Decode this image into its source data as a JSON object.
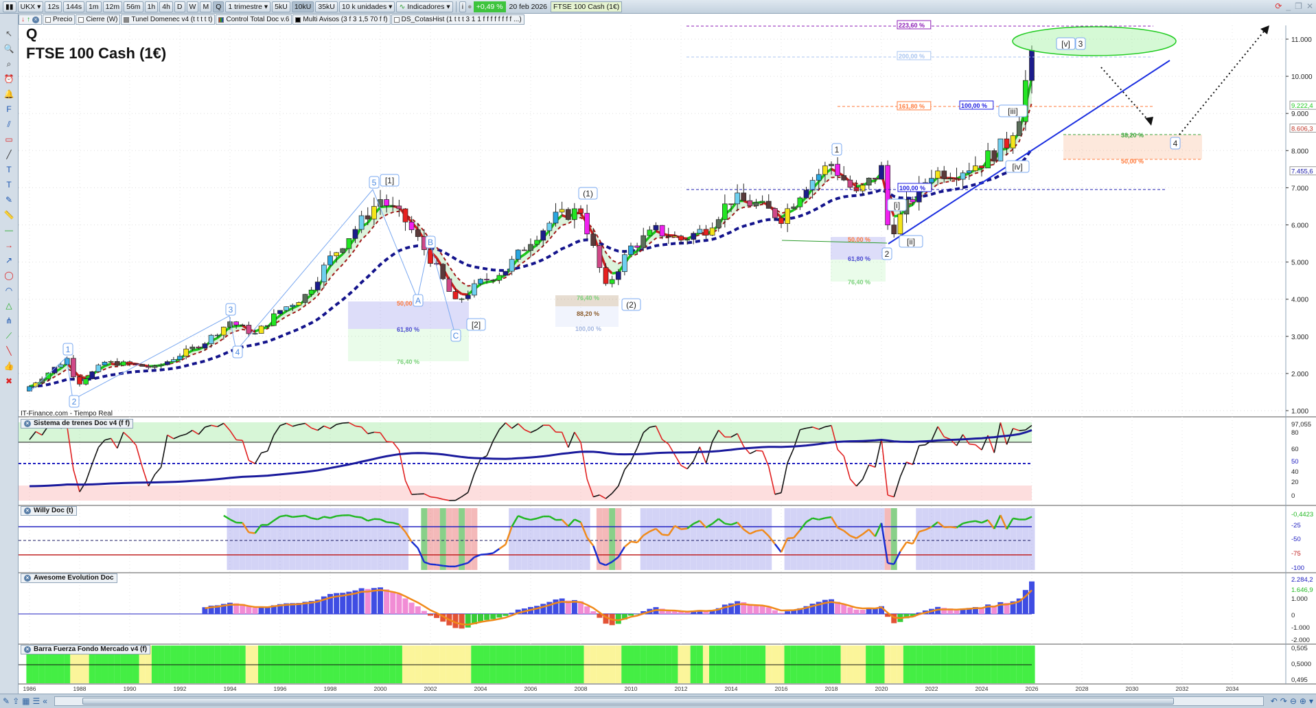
{
  "toolbar": {
    "symbol": "UKX",
    "timeframes": [
      "12s",
      "144s",
      "1m",
      "12m",
      "56m",
      "1h",
      "4h",
      "D",
      "W",
      "M",
      "Q"
    ],
    "active_timeframe": "Q",
    "period": "1 trimestre",
    "volumes": [
      "5kU",
      "10kU",
      "35kU"
    ],
    "active_volume": "10kU",
    "units": "10 k unidades",
    "indicators": "Indicadores",
    "change": "+0,49 %",
    "date": "20 feb 2026",
    "instrument": "FTSE 100 Cash (1€)"
  },
  "indicator_tabs": [
    "Precio",
    "Cierre (W)",
    "Tunel Domenec v4 (t t t t t)",
    "Control Total Doc v.6",
    "Multi Avisos (3 f 3 1,5 70 f f)",
    "DS_CotasHist (1 t t t 3 1 1 f f f f f f f f ...)"
  ],
  "header": {
    "timeframe_letter": "Q",
    "title": "FTSE 100 Cash (1€)",
    "watermark": "IT-Finance.com - Tiempo Real"
  },
  "price_axis": [
    "11.000",
    "10.000",
    "9.000",
    "8.000",
    "7.000",
    "6.000",
    "5.000",
    "4.000",
    "3.000",
    "2.000",
    "1.000"
  ],
  "price_tags": [
    {
      "label": "9.222,4",
      "color": "#22cc22"
    },
    {
      "label": "8.606,3",
      "color": "#c0392b"
    },
    {
      "label": "7.455,6",
      "color": "#1a1aa8"
    }
  ],
  "fib_labels": {
    "f2236": "223,60 %",
    "f200": "200,00 %",
    "f1618": "161,80 %",
    "f100a": "100,00 %",
    "f382": "38,20 %",
    "f50a": "50,00 %",
    "f100b": "100,00 %",
    "f50b": "50,00 %",
    "f618b": "61,80 %",
    "f764b": "76,40 %",
    "f764c": "76,40 %",
    "f882c": "88,20 %",
    "f100c": "100,00 %",
    "f50d": "50,00",
    "f618d": "61,80 %",
    "f764d": "76,40 %"
  },
  "wave_labels": {
    "e1": "1",
    "e2": "2",
    "e3": "3",
    "e4": "4",
    "e5": "5",
    "w1": "[1]",
    "A": "A",
    "B": "B",
    "C": "C",
    "w2": "[2]",
    "p1": "(1)",
    "p2": "(2)",
    "m1": "1",
    "m2": "2",
    "mi": "[i]",
    "mii": "[ii]",
    "miii": "[iii]",
    "miv": "[iv]",
    "mv": "[v]",
    "m3": "3",
    "m4": "4"
  },
  "panels": [
    {
      "title": "Sistema de trenes Doc v4 (f f)",
      "axis": [
        "97,055",
        "80",
        "60",
        "50",
        "40",
        "20",
        "0"
      ]
    },
    {
      "title": "Willy Doc (t)",
      "axis": [
        "-0,4423",
        "-25",
        "-50",
        "-75",
        "-100"
      ]
    },
    {
      "title": "Awesome Evolution Doc",
      "axis": [
        "2.284,2",
        "1.646,9",
        "1.000",
        "0",
        "-1.000",
        "-2.000"
      ]
    },
    {
      "title": "Barra Fuerza Fondo Mercado v4 (f)",
      "axis": [
        "0,505",
        "0,5000",
        "0,495"
      ]
    }
  ],
  "time_axis": [
    "1986",
    "1988",
    "1990",
    "1992",
    "1994",
    "1996",
    "1998",
    "2000",
    "2002",
    "2004",
    "2006",
    "2008",
    "2010",
    "2012",
    "2014",
    "2016",
    "2018",
    "2020",
    "2022",
    "2024",
    "2026",
    "2028",
    "2030",
    "2032",
    "2034"
  ],
  "left_tools": [
    "cursor-icon",
    "zoom-icon",
    "zoom-area-icon",
    "alarm-icon",
    "bell-icon",
    "fib-icon",
    "channel-icon",
    "rectangle-icon",
    "line-icon",
    "text-icon",
    "text-alt-icon",
    "pencil-icon",
    "ruler-icon",
    "horizontal-line-icon",
    "ray-icon",
    "arrow-icon",
    "ellipse-icon",
    "arc-icon",
    "triangle-icon",
    "pitchfork-icon",
    "trend-icon",
    "color-line-icon",
    "thumbs-up-icon",
    "delete-icon"
  ],
  "chart_data": {
    "type": "candlestick",
    "title": "FTSE 100 Cash (1€)",
    "timeframe": "quarterly",
    "ylabel": "Price",
    "ylim": [
      700,
      11400
    ],
    "xlim": [
      1985.8,
      2035
    ],
    "approx_yearly_levels": {
      "x": [
        1985.5,
        1987.5,
        1987.9,
        1989,
        1990,
        1991,
        1992,
        1993,
        1994,
        1995,
        1996,
        1997,
        1998,
        1999,
        2000,
        2001,
        2002,
        2003,
        2004,
        2005,
        2006,
        2007,
        2008,
        2009,
        2010,
        2011,
        2012,
        2013,
        2014,
        2015,
        2016,
        2017,
        2018,
        2019,
        2020,
        2020.3,
        2021,
        2022,
        2023,
        2024,
        2025,
        2025.5,
        2026
      ],
      "y": [
        1400,
        2400,
        1700,
        2300,
        2250,
        2150,
        2500,
        2850,
        3400,
        3050,
        3700,
        4100,
        5100,
        5900,
        6700,
        6100,
        5100,
        3900,
        4450,
        4800,
        5600,
        6200,
        6400,
        4300,
        5400,
        5850,
        5600,
        5900,
        6700,
        6550,
        6200,
        7100,
        7650,
        6800,
        7500,
        5700,
        6500,
        7400,
        7450,
        7700,
        8200,
        9000,
        10700
      ]
    }
  }
}
